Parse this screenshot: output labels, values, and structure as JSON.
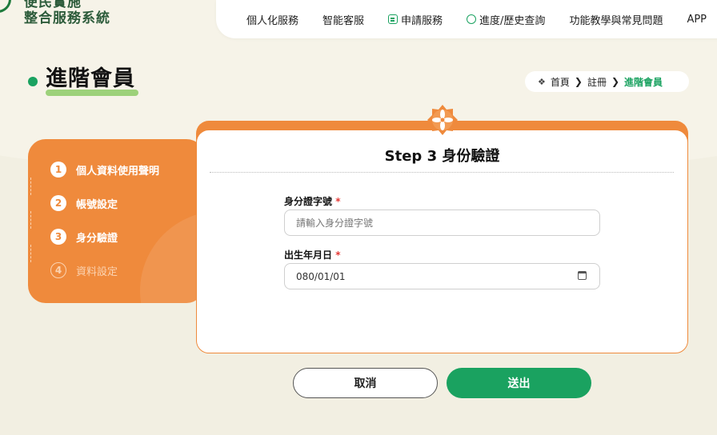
{
  "logo": {
    "line1": "便民實施",
    "line2": "整合服務系統"
  },
  "nav": {
    "items": [
      {
        "label": "個人化服務"
      },
      {
        "label": "智能客服"
      },
      {
        "label": "申請服務",
        "icon": "apply-icon"
      },
      {
        "label": "進度/歷史查詢",
        "icon": "search-icon"
      },
      {
        "label": "功能教學與常見問題"
      },
      {
        "label": "APP"
      }
    ]
  },
  "page": {
    "title": "進階會員"
  },
  "breadcrumb": {
    "home": "首頁",
    "register": "註冊",
    "current": "進階會員"
  },
  "steps": [
    {
      "num": "1",
      "label": "個人資料使用聲明"
    },
    {
      "num": "2",
      "label": "帳號設定"
    },
    {
      "num": "3",
      "label": "身分驗證"
    },
    {
      "num": "4",
      "label": "資料設定"
    }
  ],
  "form": {
    "title": "Step 3 身份驗證",
    "id_label": "身分證字號",
    "id_placeholder": "請輸入身分證字號",
    "dob_label": "出生年月日",
    "dob_value": "080/01/01",
    "required_mark": "*"
  },
  "buttons": {
    "cancel": "取消",
    "submit": "送出"
  },
  "colors": {
    "accent_orange": "#ef8a3c",
    "accent_green": "#1aa260",
    "underline_green": "#9dd17a"
  }
}
